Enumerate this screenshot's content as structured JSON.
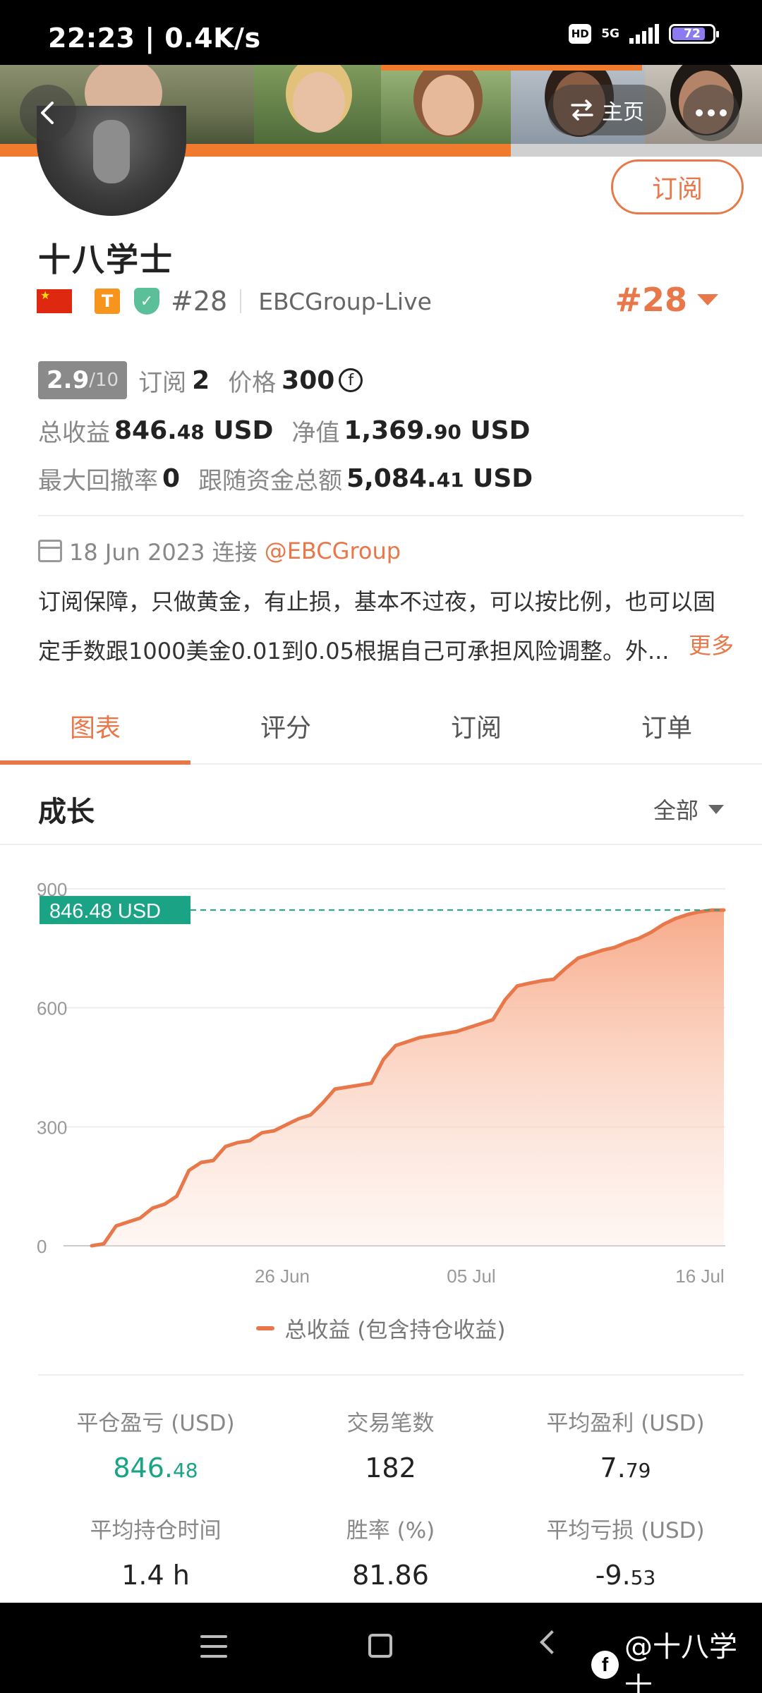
{
  "status_bar": {
    "time": "22:23 | 0.4K/s",
    "hd": "HD",
    "network": "5G",
    "battery": "72"
  },
  "header": {
    "home_label": "主页",
    "back_icon": "chevron-left-icon",
    "more_icon": "more-dots-icon"
  },
  "profile": {
    "subscribe_label": "订阅",
    "name": "十八学士",
    "t_badge": "T",
    "rank_label": "#28",
    "server": "EBCGroup-Live",
    "rank_highlight": "#28",
    "score": "2.9",
    "score_max": "/10",
    "subscribe_count_label": "订阅",
    "subscribe_count": "2",
    "price_label": "价格",
    "price": "300",
    "coin_symbol": "f",
    "total_profit_label": "总收益",
    "total_profit_int": "846.",
    "total_profit_dec": "48",
    "total_profit_unit": "USD",
    "equity_label": "净值",
    "equity_int": "1,369.",
    "equity_dec": "90",
    "equity_unit": "USD",
    "max_drawdown_label": "最大回撤率",
    "max_drawdown": "0",
    "follow_funds_label": "跟随资金总额",
    "follow_funds_int": "5,084.",
    "follow_funds_dec": "41",
    "follow_funds_unit": "USD",
    "connect_date": "18 Jun 2023 连接",
    "connect_handle": "@EBCGroup",
    "description_line1": "订阅保障，只做黄金，有止损，基本不过夜，可以按比例，也可以固",
    "description_line2": "定手数跟1000美金0.01到0.05根据自己可承担风险调整。外...",
    "more_label": "更多"
  },
  "tabs": [
    {
      "label": "图表",
      "active": true
    },
    {
      "label": "评分",
      "active": false
    },
    {
      "label": "订阅",
      "active": false
    },
    {
      "label": "订单",
      "active": false
    }
  ],
  "growth": {
    "title": "成长",
    "range_label": "全部"
  },
  "chart_data": {
    "type": "area",
    "title": "",
    "xlabel": "",
    "ylabel": "",
    "ylim": [
      0,
      900
    ],
    "yticks": [
      "0",
      "300",
      "600",
      "900"
    ],
    "xticks": [
      "26 Jun",
      "05 Jul",
      "16 Jul"
    ],
    "current_label": "846.48 USD",
    "current_value": 846.48,
    "line_color": "#e8774a",
    "fill_color": "#f7b79a",
    "grid": true,
    "legend": "bottom",
    "series": [
      {
        "name": "总收益 (包含持仓收益)",
        "values": [
          0,
          5,
          50,
          60,
          70,
          95,
          105,
          125,
          190,
          210,
          215,
          250,
          260,
          265,
          285,
          290,
          305,
          320,
          330,
          360,
          395,
          400,
          405,
          410,
          470,
          505,
          515,
          525,
          530,
          535,
          540,
          550,
          560,
          570,
          620,
          655,
          662,
          668,
          672,
          700,
          725,
          735,
          745,
          752,
          765,
          775,
          790,
          810,
          825,
          835,
          842,
          846.48,
          846.48
        ]
      }
    ]
  },
  "metrics": [
    {
      "label": "平仓盈亏 (USD)",
      "int": "846.",
      "dec": "48",
      "color": "green"
    },
    {
      "label": "交易笔数",
      "int": "182",
      "dec": "",
      "color": "normal"
    },
    {
      "label": "平均盈利 (USD)",
      "int": "7.",
      "dec": "79",
      "color": "normal"
    },
    {
      "label": "平均持仓时间",
      "int": "1.4 h",
      "dec": "",
      "color": "normal"
    },
    {
      "label": "胜率 (%)",
      "int": "81.86",
      "dec": "",
      "color": "normal"
    },
    {
      "label": "平均亏损 (USD)",
      "int": "-9.",
      "dec": "53",
      "color": "normal"
    }
  ],
  "nav": {
    "watermark": "@十八学士",
    "fb_letter": "f"
  }
}
